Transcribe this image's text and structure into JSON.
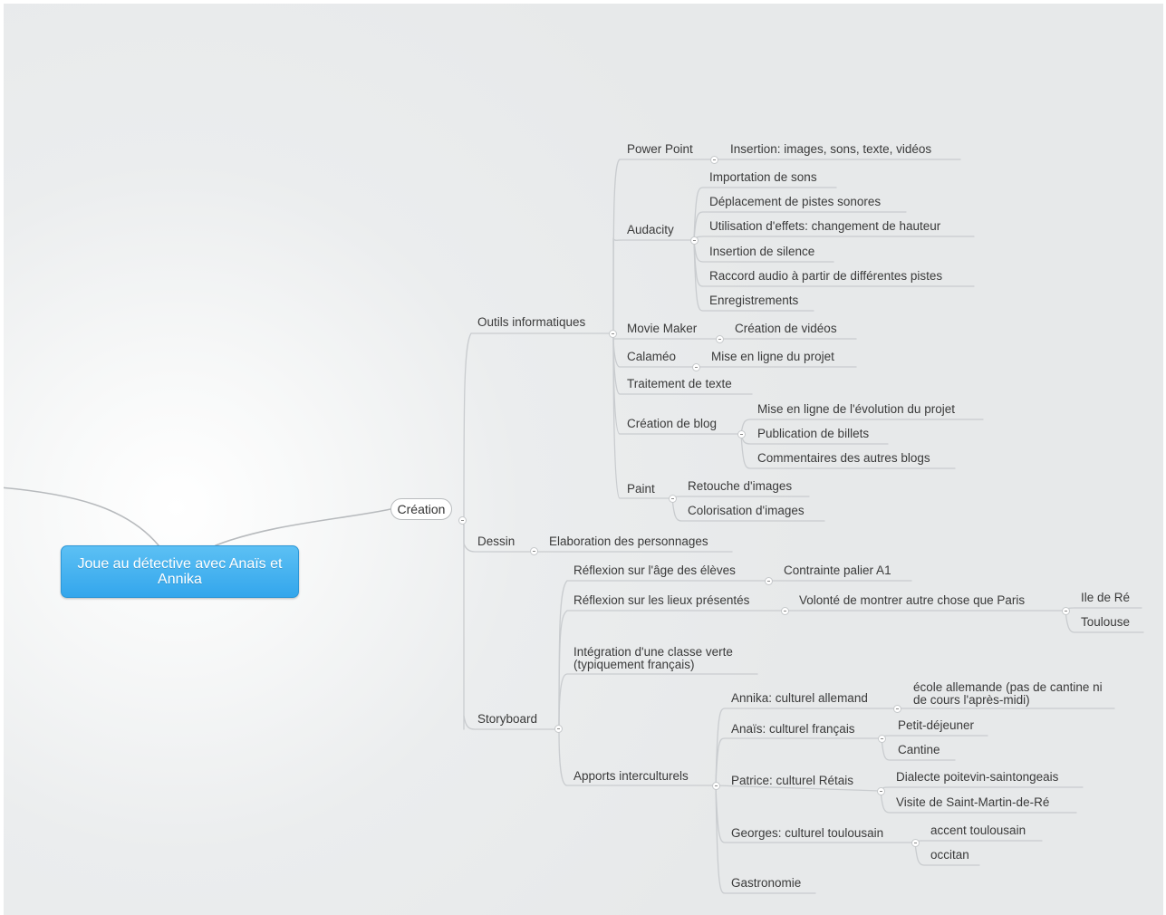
{
  "map": {
    "root": "Joue au détective avec Anaïs et Annika",
    "creation": "Création",
    "outils": "Outils informatiques",
    "powerpoint": "Power Point",
    "powerpoint_insertion": "Insertion: images, sons, texte, vidéos",
    "audacity": "Audacity",
    "audacity_items": [
      "Importation de sons",
      "Déplacement de pistes sonores",
      "Utilisation d'effets: changement de hauteur",
      "Insertion de silence",
      "Raccord audio à partir de différentes pistes",
      "Enregistrements"
    ],
    "moviemaker": "Movie Maker",
    "moviemaker_child": "Création de vidéos",
    "calameo": "Calaméo",
    "calameo_child": "Mise en ligne du projet",
    "traitement": "Traitement de texte",
    "blog": "Création de blog",
    "blog_items": [
      "Mise en ligne de l'évolution du projet",
      "Publication de billets",
      "Commentaires des autres blogs"
    ],
    "paint": "Paint",
    "paint_items": [
      "Retouche d'images",
      "Colorisation d'images"
    ],
    "dessin": "Dessin",
    "dessin_child": "Elaboration des personnages",
    "storyboard": "Storyboard",
    "reflexion_age": "Réflexion sur l'âge des élèves",
    "contrainte": "Contrainte palier A1",
    "reflexion_lieux": "Réflexion sur les lieux présentés",
    "volonte": "Volonté de montrer autre chose que Paris",
    "ile_de_re": "Ile de Ré",
    "toulouse": "Toulouse",
    "integration": "Intégration d'une classe verte (typiquement français)",
    "apports": "Apports interculturels",
    "annika": "Annika: culturel allemand",
    "annika_child": "école allemande (pas de cantine ni de cours l'après-midi)",
    "anais": "Anaïs: culturel français",
    "anais_items": [
      "Petit-déjeuner",
      "Cantine"
    ],
    "patrice": "Patrice: culturel Rétais",
    "patrice_items": [
      "Dialecte poitevin-saintongeais",
      "Visite de Saint-Martin-de-Ré"
    ],
    "georges": "Georges: culturel toulousain",
    "georges_items": [
      "accent toulousain",
      "occitan"
    ],
    "gastronomie": "Gastronomie"
  }
}
